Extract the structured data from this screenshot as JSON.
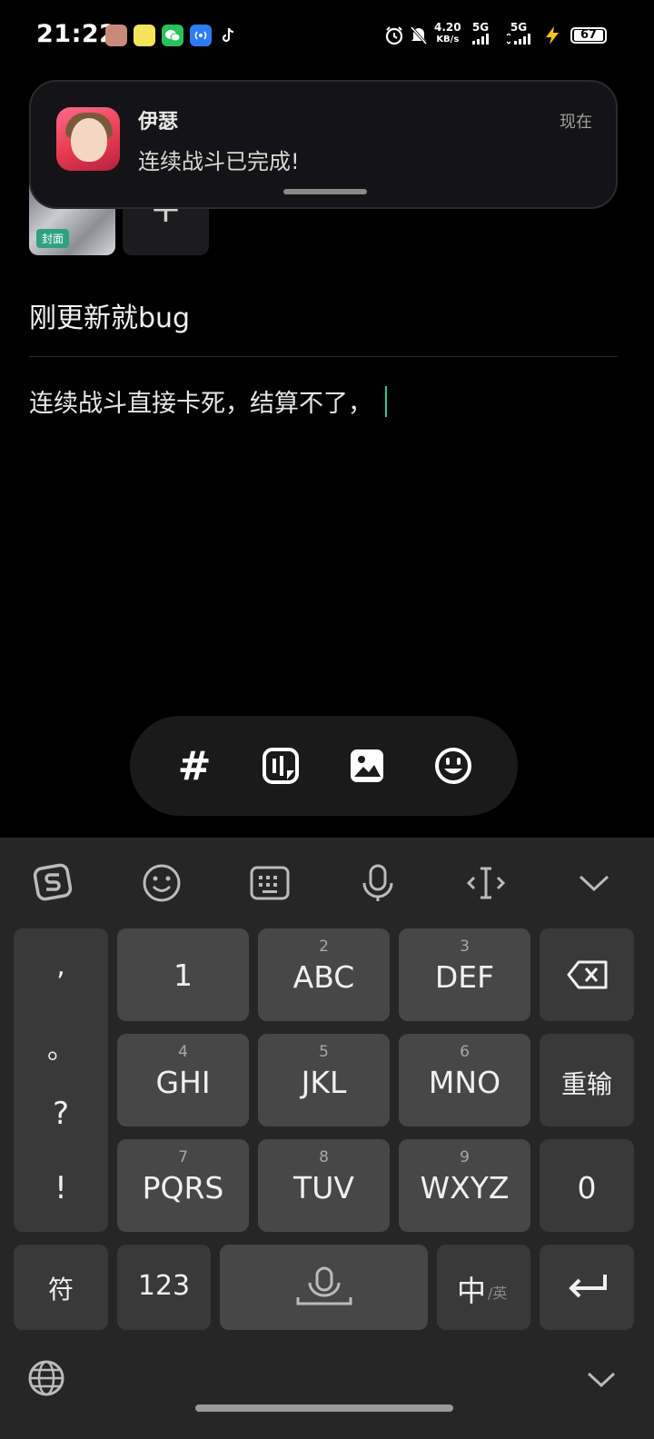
{
  "status_bar": {
    "time": "21:22",
    "net_speed": "4.20",
    "net_unit": "KB/s",
    "sim1": "5G",
    "sim2": "5G",
    "battery": "67"
  },
  "notification": {
    "app_name": "伊瑟",
    "message": "连续战斗已完成!",
    "time": "现在"
  },
  "cover": {
    "badge": "封面"
  },
  "post": {
    "title": "刚更新就bug",
    "body": "连续战斗直接卡死，结算不了，"
  },
  "toolbar": {
    "hashtag": "#"
  },
  "keyboard": {
    "punct": [
      ",",
      "。",
      "?",
      "!"
    ],
    "keys": [
      {
        "num": "",
        "label": "1"
      },
      {
        "num": "2",
        "label": "ABC"
      },
      {
        "num": "3",
        "label": "DEF"
      },
      {
        "num": "4",
        "label": "GHI"
      },
      {
        "num": "5",
        "label": "JKL"
      },
      {
        "num": "6",
        "label": "MNO"
      },
      {
        "num": "7",
        "label": "PQRS"
      },
      {
        "num": "8",
        "label": "TUV"
      },
      {
        "num": "9",
        "label": "WXYZ"
      }
    ],
    "reenter": "重输",
    "zero": "0",
    "symbols": "符",
    "numbers": "123",
    "lang_main": "中",
    "lang_alt": "/英"
  },
  "colors": {
    "accent": "#2ec4a0",
    "keyboard_bg": "#262626",
    "key_bg": "#474747"
  }
}
